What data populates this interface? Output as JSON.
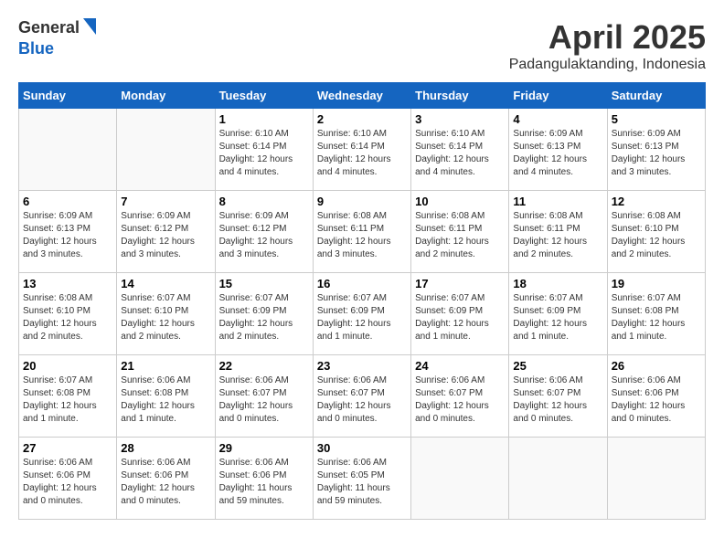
{
  "header": {
    "logo_general": "General",
    "logo_blue": "Blue",
    "month_title": "April 2025",
    "location": "Padangulaktanding, Indonesia"
  },
  "days_of_week": [
    "Sunday",
    "Monday",
    "Tuesday",
    "Wednesday",
    "Thursday",
    "Friday",
    "Saturday"
  ],
  "weeks": [
    [
      {
        "day": "",
        "info": ""
      },
      {
        "day": "",
        "info": ""
      },
      {
        "day": "1",
        "info": "Sunrise: 6:10 AM\nSunset: 6:14 PM\nDaylight: 12 hours\nand 4 minutes."
      },
      {
        "day": "2",
        "info": "Sunrise: 6:10 AM\nSunset: 6:14 PM\nDaylight: 12 hours\nand 4 minutes."
      },
      {
        "day": "3",
        "info": "Sunrise: 6:10 AM\nSunset: 6:14 PM\nDaylight: 12 hours\nand 4 minutes."
      },
      {
        "day": "4",
        "info": "Sunrise: 6:09 AM\nSunset: 6:13 PM\nDaylight: 12 hours\nand 4 minutes."
      },
      {
        "day": "5",
        "info": "Sunrise: 6:09 AM\nSunset: 6:13 PM\nDaylight: 12 hours\nand 3 minutes."
      }
    ],
    [
      {
        "day": "6",
        "info": "Sunrise: 6:09 AM\nSunset: 6:13 PM\nDaylight: 12 hours\nand 3 minutes."
      },
      {
        "day": "7",
        "info": "Sunrise: 6:09 AM\nSunset: 6:12 PM\nDaylight: 12 hours\nand 3 minutes."
      },
      {
        "day": "8",
        "info": "Sunrise: 6:09 AM\nSunset: 6:12 PM\nDaylight: 12 hours\nand 3 minutes."
      },
      {
        "day": "9",
        "info": "Sunrise: 6:08 AM\nSunset: 6:11 PM\nDaylight: 12 hours\nand 3 minutes."
      },
      {
        "day": "10",
        "info": "Sunrise: 6:08 AM\nSunset: 6:11 PM\nDaylight: 12 hours\nand 2 minutes."
      },
      {
        "day": "11",
        "info": "Sunrise: 6:08 AM\nSunset: 6:11 PM\nDaylight: 12 hours\nand 2 minutes."
      },
      {
        "day": "12",
        "info": "Sunrise: 6:08 AM\nSunset: 6:10 PM\nDaylight: 12 hours\nand 2 minutes."
      }
    ],
    [
      {
        "day": "13",
        "info": "Sunrise: 6:08 AM\nSunset: 6:10 PM\nDaylight: 12 hours\nand 2 minutes."
      },
      {
        "day": "14",
        "info": "Sunrise: 6:07 AM\nSunset: 6:10 PM\nDaylight: 12 hours\nand 2 minutes."
      },
      {
        "day": "15",
        "info": "Sunrise: 6:07 AM\nSunset: 6:09 PM\nDaylight: 12 hours\nand 2 minutes."
      },
      {
        "day": "16",
        "info": "Sunrise: 6:07 AM\nSunset: 6:09 PM\nDaylight: 12 hours\nand 1 minute."
      },
      {
        "day": "17",
        "info": "Sunrise: 6:07 AM\nSunset: 6:09 PM\nDaylight: 12 hours\nand 1 minute."
      },
      {
        "day": "18",
        "info": "Sunrise: 6:07 AM\nSunset: 6:09 PM\nDaylight: 12 hours\nand 1 minute."
      },
      {
        "day": "19",
        "info": "Sunrise: 6:07 AM\nSunset: 6:08 PM\nDaylight: 12 hours\nand 1 minute."
      }
    ],
    [
      {
        "day": "20",
        "info": "Sunrise: 6:07 AM\nSunset: 6:08 PM\nDaylight: 12 hours\nand 1 minute."
      },
      {
        "day": "21",
        "info": "Sunrise: 6:06 AM\nSunset: 6:08 PM\nDaylight: 12 hours\nand 1 minute."
      },
      {
        "day": "22",
        "info": "Sunrise: 6:06 AM\nSunset: 6:07 PM\nDaylight: 12 hours\nand 0 minutes."
      },
      {
        "day": "23",
        "info": "Sunrise: 6:06 AM\nSunset: 6:07 PM\nDaylight: 12 hours\nand 0 minutes."
      },
      {
        "day": "24",
        "info": "Sunrise: 6:06 AM\nSunset: 6:07 PM\nDaylight: 12 hours\nand 0 minutes."
      },
      {
        "day": "25",
        "info": "Sunrise: 6:06 AM\nSunset: 6:07 PM\nDaylight: 12 hours\nand 0 minutes."
      },
      {
        "day": "26",
        "info": "Sunrise: 6:06 AM\nSunset: 6:06 PM\nDaylight: 12 hours\nand 0 minutes."
      }
    ],
    [
      {
        "day": "27",
        "info": "Sunrise: 6:06 AM\nSunset: 6:06 PM\nDaylight: 12 hours\nand 0 minutes."
      },
      {
        "day": "28",
        "info": "Sunrise: 6:06 AM\nSunset: 6:06 PM\nDaylight: 12 hours\nand 0 minutes."
      },
      {
        "day": "29",
        "info": "Sunrise: 6:06 AM\nSunset: 6:06 PM\nDaylight: 11 hours\nand 59 minutes."
      },
      {
        "day": "30",
        "info": "Sunrise: 6:06 AM\nSunset: 6:05 PM\nDaylight: 11 hours\nand 59 minutes."
      },
      {
        "day": "",
        "info": ""
      },
      {
        "day": "",
        "info": ""
      },
      {
        "day": "",
        "info": ""
      }
    ]
  ]
}
